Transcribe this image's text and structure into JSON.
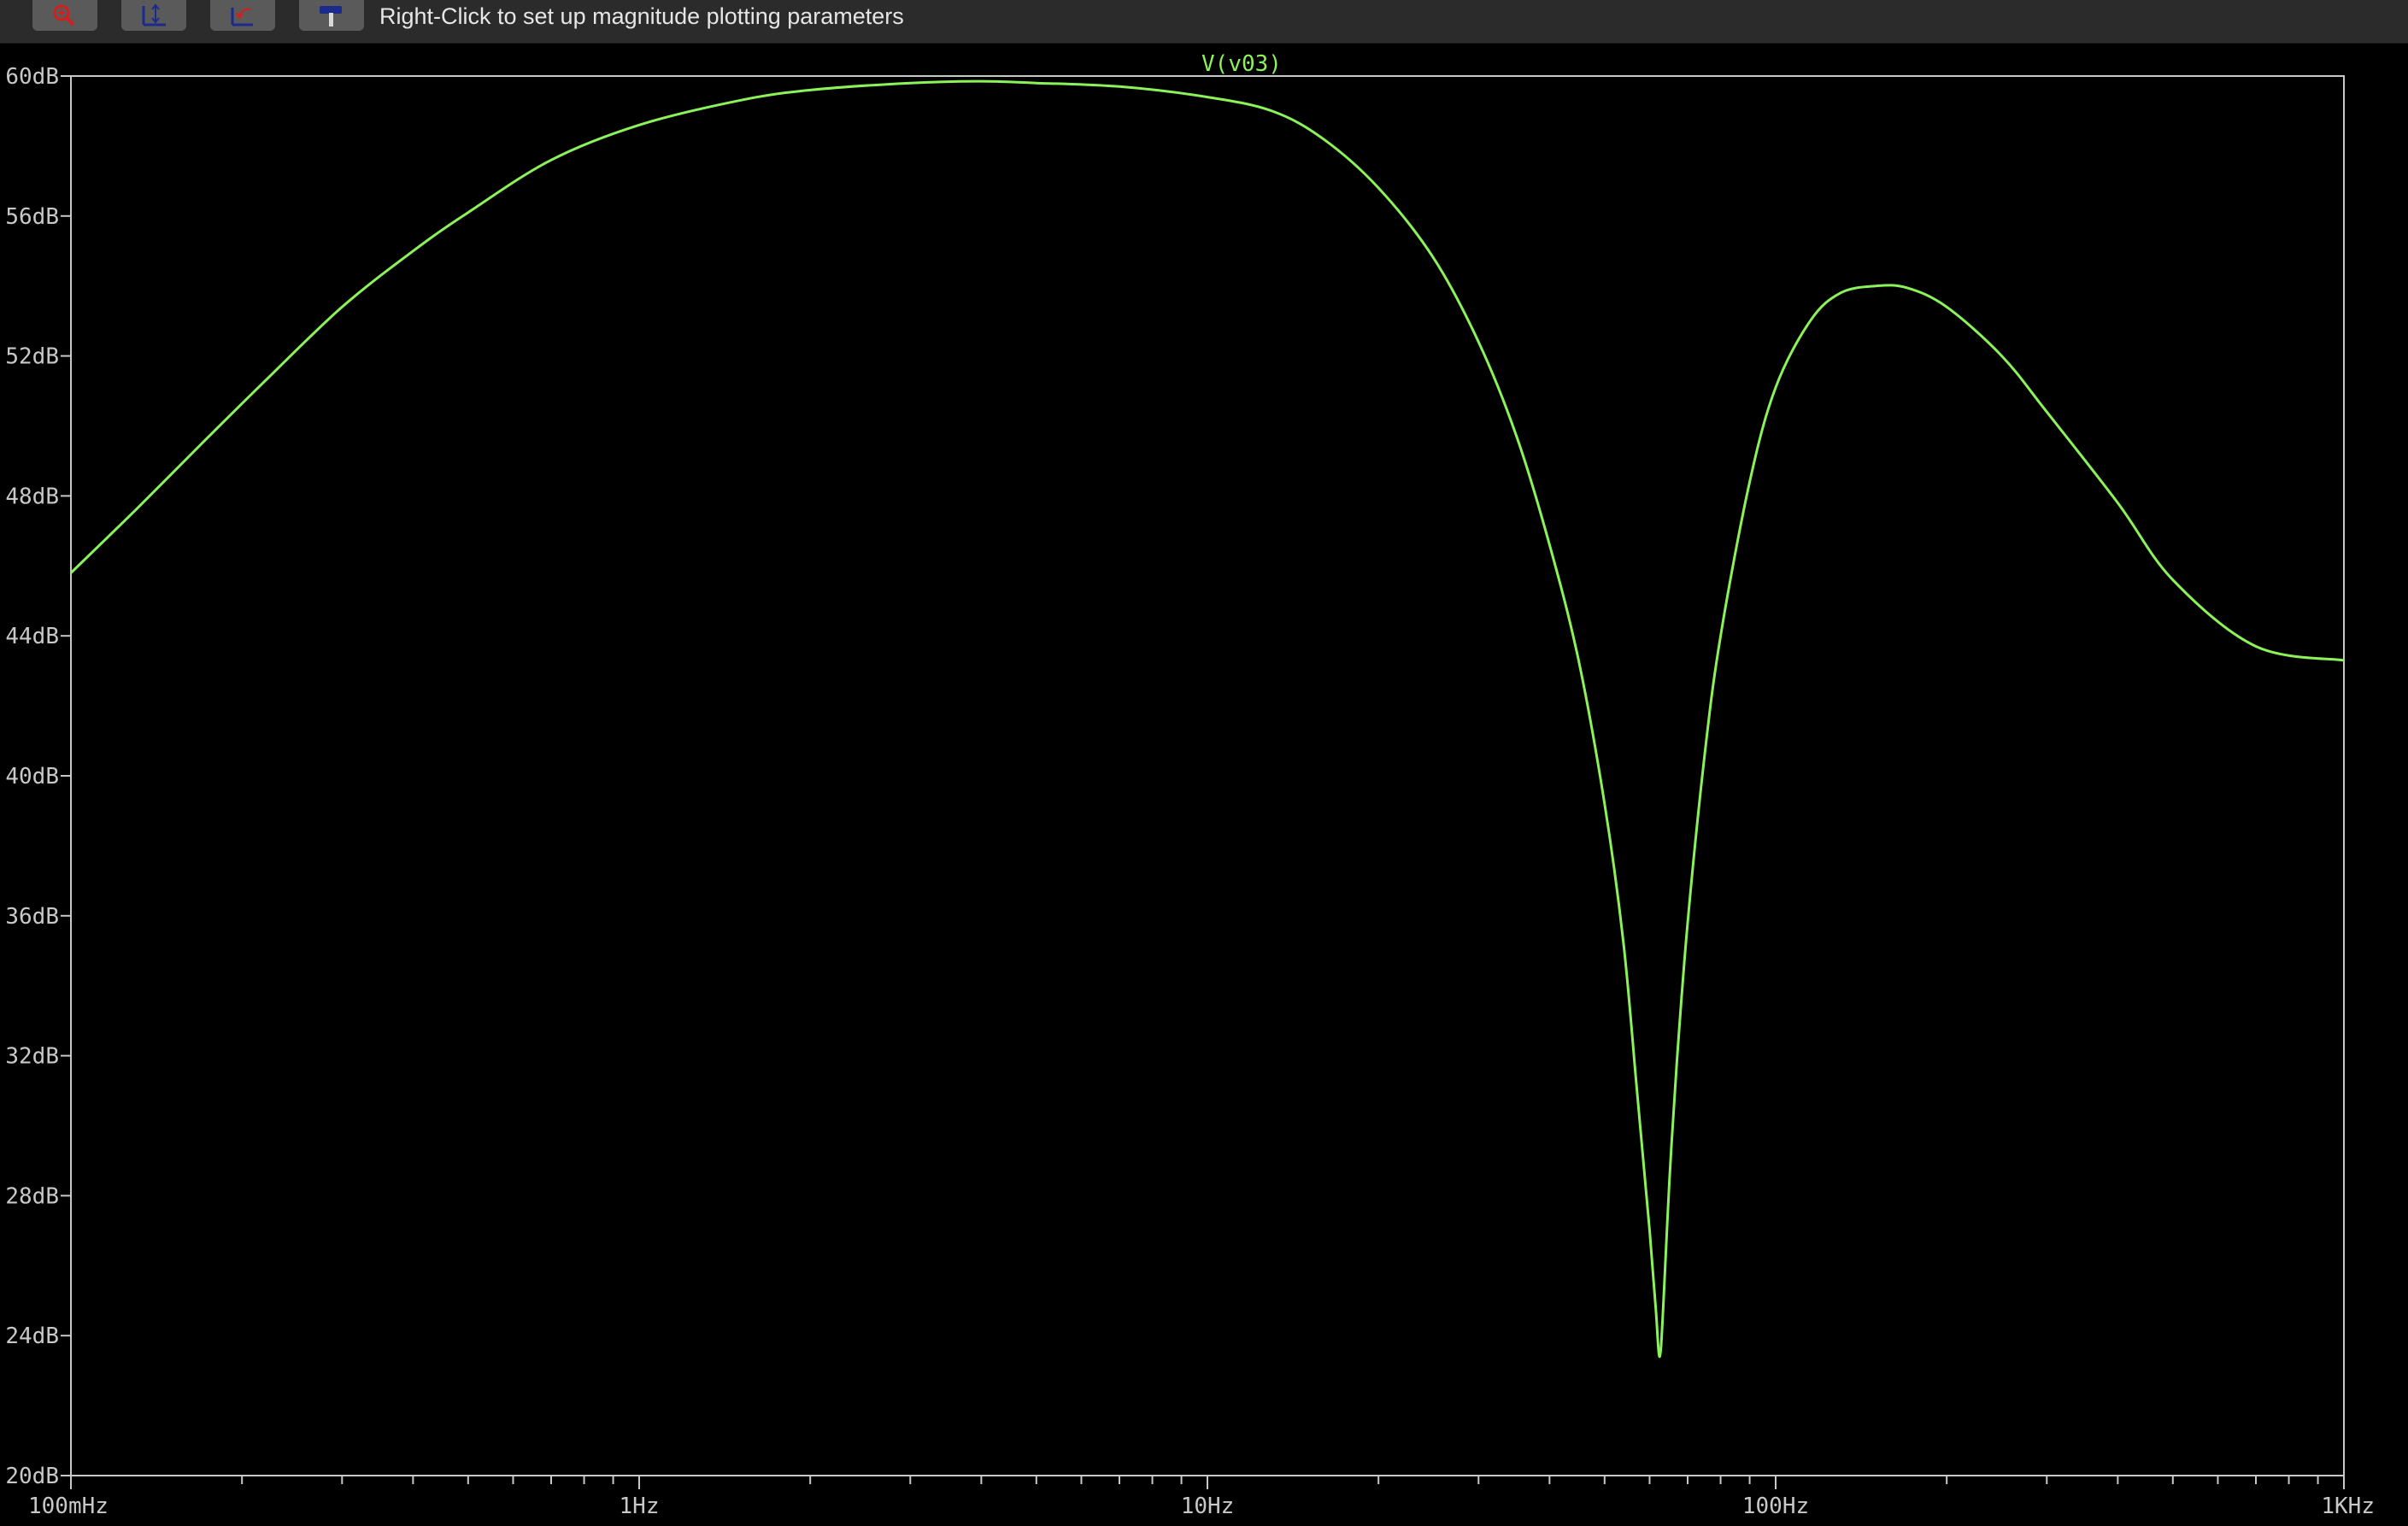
{
  "toolbar": {
    "buttons": [
      {
        "name": "zoom-button",
        "icon": "magnifier-zoom-icon"
      },
      {
        "name": "autorange-button",
        "icon": "autorange-axes-icon"
      },
      {
        "name": "zoom-back-button",
        "icon": "zoom-back-icon"
      },
      {
        "name": "tools-button",
        "icon": "hammer-icon"
      }
    ],
    "hint": "Right-Click to set up magnitude plotting parameters"
  },
  "colors": {
    "background": "#000000",
    "trace": "#8cf25a",
    "axis": "#c8c8c8",
    "toolbar": "#2b2b2b"
  },
  "chart_data": {
    "type": "line",
    "title": "",
    "x_scale": "log",
    "x_unit": "Hz",
    "y_unit": "dB",
    "xlim": [
      0.1,
      1000
    ],
    "ylim": [
      20,
      60
    ],
    "x_ticks": [
      {
        "value": 0.1,
        "label": "100mHz"
      },
      {
        "value": 1,
        "label": "1Hz"
      },
      {
        "value": 10,
        "label": "10Hz"
      },
      {
        "value": 100,
        "label": "100Hz"
      },
      {
        "value": 1000,
        "label": "1KHz"
      }
    ],
    "y_ticks": [
      {
        "value": 60,
        "label": "60dB"
      },
      {
        "value": 56,
        "label": "56dB"
      },
      {
        "value": 52,
        "label": "52dB"
      },
      {
        "value": 48,
        "label": "48dB"
      },
      {
        "value": 44,
        "label": "44dB"
      },
      {
        "value": 40,
        "label": "40dB"
      },
      {
        "value": 36,
        "label": "36dB"
      },
      {
        "value": 32,
        "label": "32dB"
      },
      {
        "value": 28,
        "label": "28dB"
      },
      {
        "value": 24,
        "label": "24dB"
      },
      {
        "value": 20,
        "label": "20dB"
      }
    ],
    "series": [
      {
        "name": "V(v03)",
        "x": [
          0.1,
          0.13,
          0.17,
          0.22,
          0.3,
          0.4,
          0.5,
          0.7,
          1.0,
          1.5,
          2.0,
          3.0,
          4.0,
          5.0,
          7.0,
          10.0,
          13.0,
          16.0,
          20.0,
          25.0,
          30.0,
          35.0,
          40.0,
          45.0,
          50.0,
          54.0,
          57.0,
          60.0,
          61.5,
          62.5,
          63.5,
          65.0,
          67.0,
          70.0,
          75.0,
          80.0,
          90.0,
          100.0,
          115.0,
          130.0,
          150.0,
          170.0,
          200.0,
          250.0,
          300.0,
          400.0,
          500.0,
          700.0,
          1000.0
        ],
        "y": [
          45.8,
          47.6,
          49.5,
          51.3,
          53.4,
          55.0,
          56.1,
          57.6,
          58.6,
          59.3,
          59.6,
          59.8,
          59.85,
          59.8,
          59.7,
          59.4,
          59.0,
          58.2,
          56.8,
          54.8,
          52.4,
          49.7,
          46.6,
          43.3,
          39.2,
          35.2,
          31.0,
          27.0,
          24.8,
          23.4,
          25.0,
          28.4,
          31.8,
          35.8,
          40.6,
          44.0,
          48.4,
          51.1,
          53.0,
          53.8,
          54.0,
          53.95,
          53.4,
          52.0,
          50.4,
          47.8,
          45.6,
          43.7,
          43.3
        ]
      }
    ]
  }
}
